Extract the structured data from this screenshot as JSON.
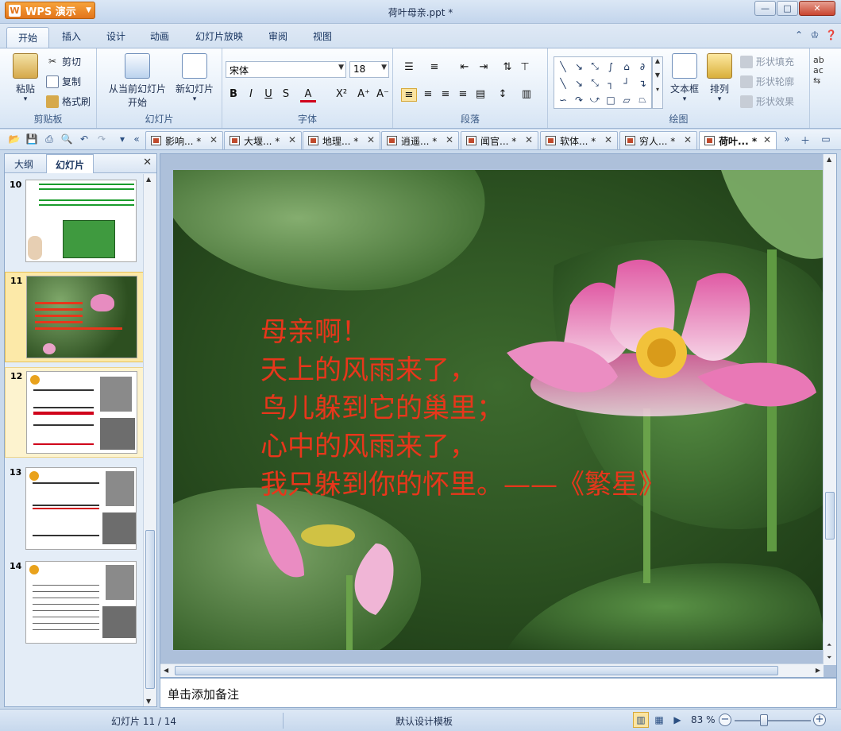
{
  "app": {
    "button_label": "WPS 演示",
    "doc_title": "荷叶母亲.ppt *"
  },
  "window": {
    "min": "—",
    "max": "□",
    "close": "✕"
  },
  "ribbon_tabs": [
    "开始",
    "插入",
    "设计",
    "动画",
    "幻灯片放映",
    "审阅",
    "视图"
  ],
  "ribbon": {
    "clipboard": {
      "paste": "粘贴",
      "cut": "剪切",
      "copy": "复制",
      "format_painter": "格式刷",
      "label": "剪贴板"
    },
    "slides": {
      "from_current": "从当前幻灯片",
      "from_current_2": "开始",
      "new_slide": "新幻灯片",
      "label": "幻灯片"
    },
    "font": {
      "name": "宋体",
      "size": "18",
      "label": "字体"
    },
    "paragraph": {
      "label": "段落"
    },
    "drawing": {
      "textbox": "文本框",
      "arrange": "排列",
      "shape_fill": "形状填充",
      "shape_outline": "形状轮廓",
      "shape_effect": "形状效果",
      "label": "绘图"
    }
  },
  "doc_tabs": [
    "影响... *",
    "大堰... *",
    "地理... *",
    "逍遥... *",
    "闻官... *",
    "软体... *",
    "穷人... *",
    "荷叶... *"
  ],
  "left_pane": {
    "tabs": [
      "大纲",
      "幻灯片"
    ],
    "close": "✕",
    "thumbs": [
      {
        "num": "10"
      },
      {
        "num": "11"
      },
      {
        "num": "12"
      },
      {
        "num": "13"
      },
      {
        "num": "14"
      }
    ]
  },
  "slide": {
    "lines": [
      "母亲啊！",
      "天上的风雨来了，",
      "鸟儿躲到它的巢里；",
      "心中的风雨来了，",
      "我只躲到你的怀里。——《繁星》"
    ]
  },
  "notes_placeholder": "单击添加备注",
  "status": {
    "slide_info": "幻灯片 11 / 14",
    "template": "默认设计模板",
    "zoom": "83 %"
  },
  "colors": {
    "poem_red": "#e8361b",
    "ribbon_blue": "#dfe9f5"
  }
}
